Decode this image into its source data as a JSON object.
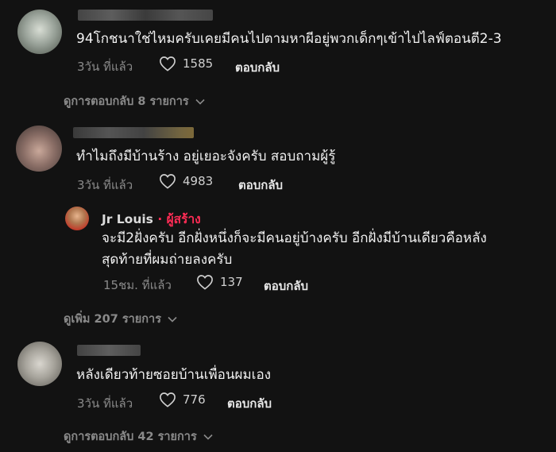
{
  "comments": [
    {
      "text": "94โกชนาใช่ไหมครับเคยมีคนไปตามหาผีอยู่พวกเด็กๆเข้าไปไลฟ์ตอนตี2-3",
      "time": "3วัน ที่แล้ว",
      "likes": "1585",
      "reply_label": "ตอบกลับ",
      "view_replies": "ดูการตอบกลับ 8 รายการ"
    },
    {
      "text": "ทำไมถึงมีบ้านร้าง อยู่เยอะจังครับ สอบถามผู้รู้",
      "time": "3วัน ที่แล้ว",
      "likes": "4983",
      "reply_label": "ตอบกลับ",
      "reply": {
        "author": "Jr Louis",
        "badge": "· ผู้สร้าง",
        "text_line1": "จะมี2ฝั่งครับ อีกฝั่งหนึ่งก็จะมีคนอยู่บ้างครับ อีกฝั่งมีบ้านเดียวคือหลัง",
        "text_line2": "สุดท้ายที่ผมถ่ายลงครับ",
        "time": "15ชม. ที่แล้ว",
        "likes": "137",
        "reply_label": "ตอบกลับ"
      },
      "view_more": "ดูเพิ่ม 207 รายการ"
    },
    {
      "text": "หลังเดียวท้ายซอยบ้านเพื่อนผมเอง",
      "time": "3วัน ที่แล้ว",
      "likes": "776",
      "reply_label": "ตอบกลับ",
      "view_replies": "ดูการตอบกลับ 42 รายการ"
    }
  ],
  "colors": {
    "background": "#121212",
    "creator_badge": "#fe2c55",
    "muted": "#8a8a8a"
  },
  "icons": {
    "like": "heart-outline-icon",
    "expand": "chevron-down-icon"
  }
}
